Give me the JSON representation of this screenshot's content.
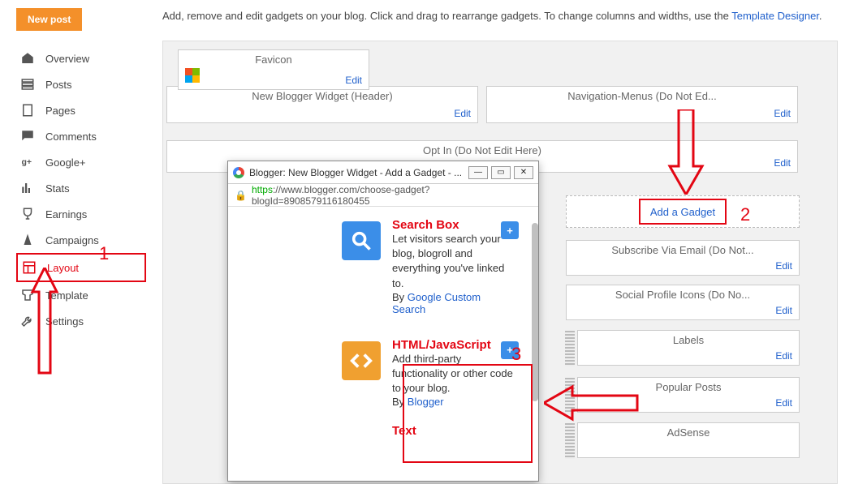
{
  "sidebar": {
    "new_post": "New post",
    "items": [
      {
        "label": "Overview",
        "icon": "home"
      },
      {
        "label": "Posts",
        "icon": "posts"
      },
      {
        "label": "Pages",
        "icon": "pages"
      },
      {
        "label": "Comments",
        "icon": "comments"
      },
      {
        "label": "Google+",
        "icon": "gplus"
      },
      {
        "label": "Stats",
        "icon": "stats"
      },
      {
        "label": "Earnings",
        "icon": "earnings"
      },
      {
        "label": "Campaigns",
        "icon": "campaigns"
      },
      {
        "label": "Layout",
        "icon": "layout"
      },
      {
        "label": "Template",
        "icon": "template"
      },
      {
        "label": "Settings",
        "icon": "settings"
      }
    ]
  },
  "intro": {
    "text": "Add, remove and edit gadgets on your blog. Click and drag to rearrange gadgets. To change columns and widths, use the ",
    "link": "Template Designer",
    "period": "."
  },
  "gadgets": {
    "favicon": "Favicon",
    "header": "New Blogger Widget (Header)",
    "nav_menus": "Navigation-Menus (Do Not Ed...",
    "optin": "Opt In (Do Not Edit Here)",
    "add_gadget": "Add a Gadget",
    "subscribe": "Subscribe Via Email (Do Not...",
    "social": "Social Profile Icons (Do No...",
    "labels": "Labels",
    "popular": "Popular Posts",
    "adsense": "AdSense",
    "edit": "Edit"
  },
  "popup": {
    "title": "Blogger: New Blogger Widget - Add a Gadget - ...",
    "url_https": "https",
    "url_rest": "://www.blogger.com/choose-gadget?blogId=8908579116180455",
    "items": [
      {
        "title": "Search Box",
        "desc": "Let visitors search your blog, blogroll and everything you've linked to.",
        "by_prefix": "By ",
        "by_link": "Google Custom Search"
      },
      {
        "title": "HTML/JavaScript",
        "desc": "Add third-party functionality or other code to your blog.",
        "by_prefix": "By ",
        "by_link": "Blogger"
      },
      {
        "title": "Text"
      }
    ]
  },
  "annotations": {
    "one": "1",
    "two": "2",
    "three": "3"
  }
}
